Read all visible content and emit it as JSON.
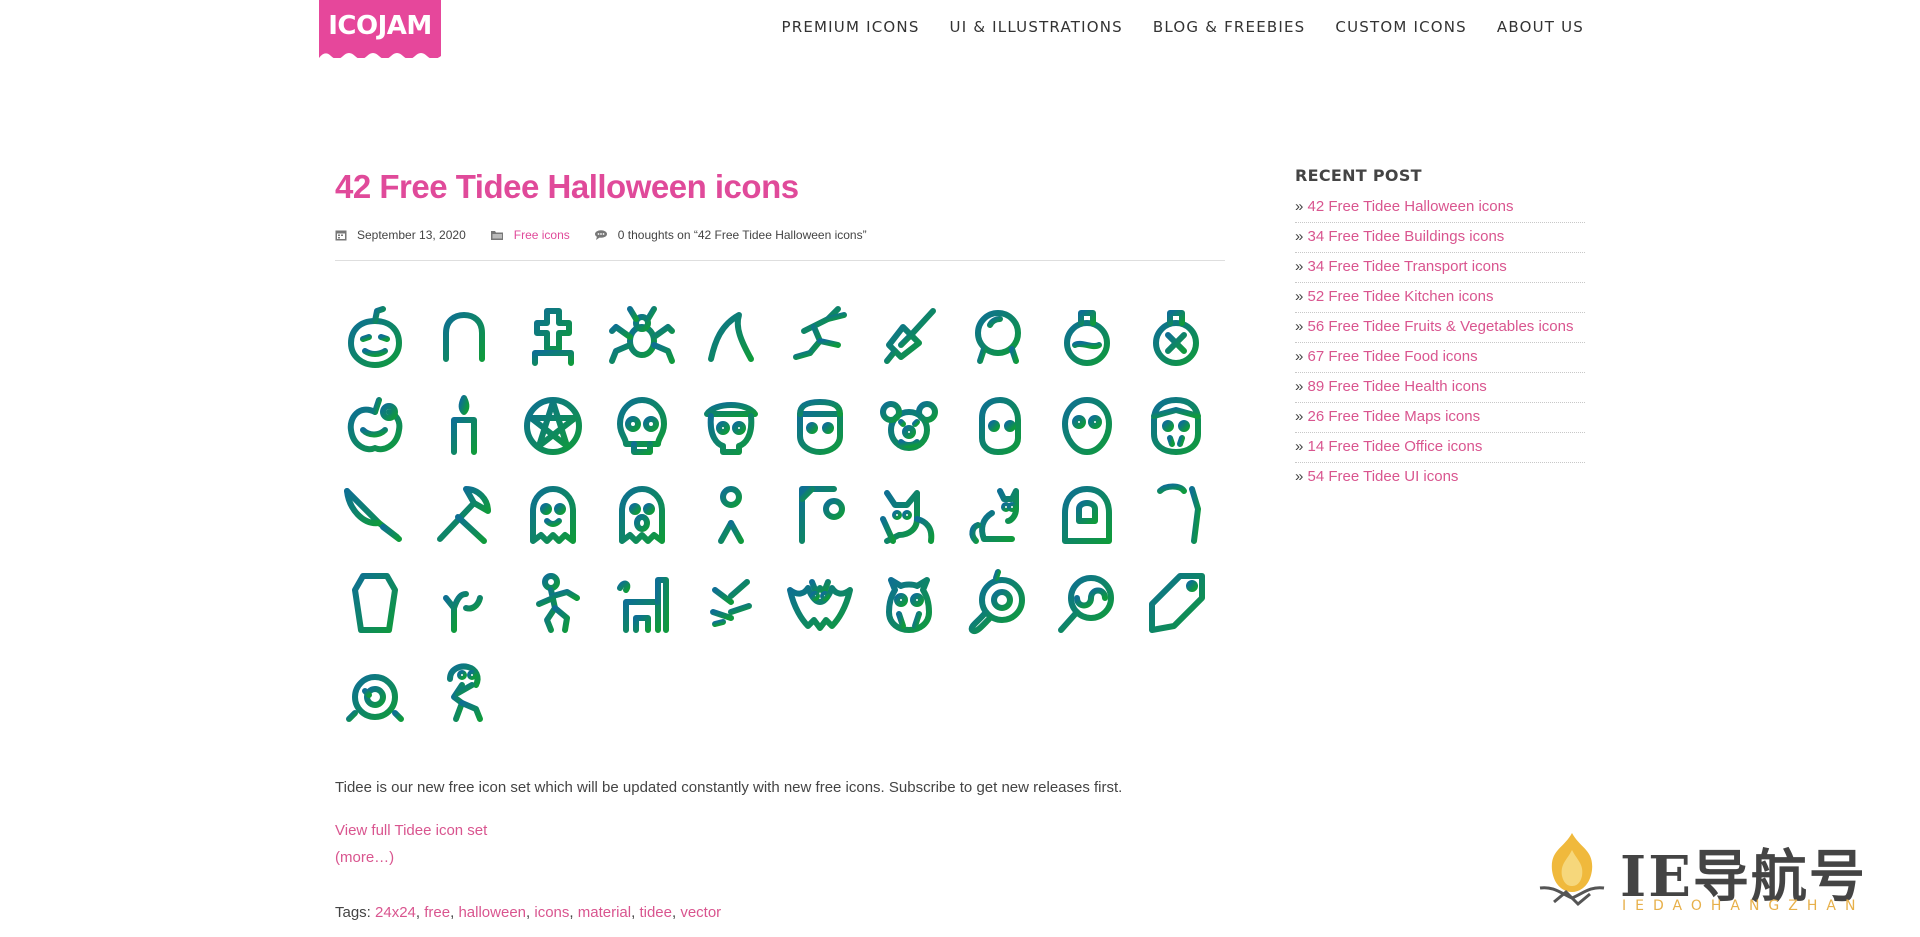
{
  "header": {
    "logo_text": "ICOJAM",
    "logo_color": "#e6479b",
    "nav": [
      {
        "label": "PREMIUM ICONS"
      },
      {
        "label": "UI & ILLUSTRATIONS"
      },
      {
        "label": "BLOG & FREEBIES"
      },
      {
        "label": "CUSTOM ICONS"
      },
      {
        "label": "ABOUT US"
      }
    ]
  },
  "post": {
    "title": "42 Free Tidee Halloween icons",
    "date": "September 13, 2020",
    "category": "Free icons",
    "comments": "0 thoughts on “42 Free Tidee Halloween icons”",
    "description": "Tidee is our new free icon set which will be updated constantly with new free icons. Subscribe to get new releases first.",
    "view_link": "View full Tidee icon set",
    "more_link": "(more…)",
    "tags_label": "Tags:",
    "tags": [
      "24x24",
      "free",
      "halloween",
      "icons",
      "material",
      "tidee",
      "vector"
    ],
    "gradient": [
      "#0e6f93",
      "#0f9a3c"
    ],
    "icons": [
      "pumpkin-icon",
      "tombstone-icon",
      "grave-cross-icon",
      "spider-icon",
      "witch-hat-icon",
      "witch-broom-icon",
      "broom-icon",
      "crystal-ball-icon",
      "potion-round-icon",
      "poison-bottle-icon",
      "bitten-apple-icon",
      "candle-icon",
      "pentagram-icon",
      "skull-icon",
      "pirate-skull-icon",
      "frankenstein-icon",
      "clown-icon",
      "zombie-face-icon",
      "stitched-head-icon",
      "vampire-icon",
      "bloody-knife-icon",
      "axe-icon",
      "ghost-icon",
      "scared-ghost-icon",
      "voodoo-doll-icon",
      "gallows-icon",
      "black-cat-icon",
      "sitting-cat-icon",
      "grim-reaper-icon",
      "skeleton-icon",
      "coffin-icon",
      "zombie-hand-icon",
      "running-zombie-icon",
      "castle-icon",
      "dead-tree-icon",
      "bat-icon",
      "owl-icon",
      "eyeball-icon",
      "lollipop-icon",
      "candy-tag-icon",
      "eye-target-icon",
      "mummy-icon"
    ]
  },
  "sidebar": {
    "title": "RECENT POST",
    "bullet": "»",
    "items": [
      {
        "label": "42 Free Tidee Halloween icons"
      },
      {
        "label": "34 Free Tidee Buildings icons"
      },
      {
        "label": "34 Free Tidee Transport icons"
      },
      {
        "label": "52 Free Tidee Kitchen icons"
      },
      {
        "label": "56 Free Tidee Fruits & Vegetables icons"
      },
      {
        "label": "67 Free Tidee Food icons"
      },
      {
        "label": "89 Free Tidee Health icons"
      },
      {
        "label": "26 Free Tidee Maps icons"
      },
      {
        "label": "14 Free Tidee Office icons"
      },
      {
        "label": "54 Free Tidee UI icons"
      }
    ]
  },
  "watermark": {
    "text": "IE导航号",
    "subtext": "IEDAOHANGZHAN",
    "accent": "#e7b04a"
  }
}
